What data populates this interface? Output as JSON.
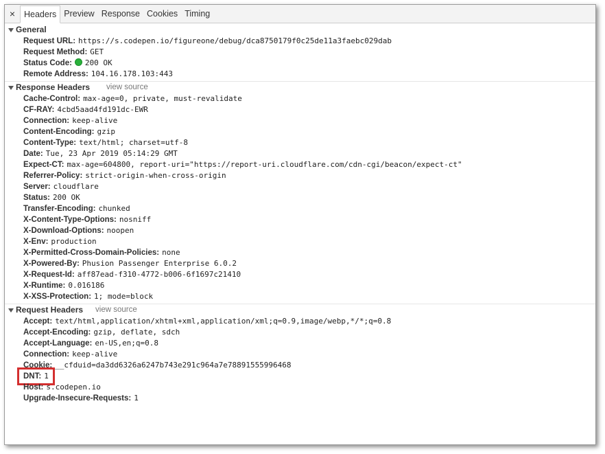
{
  "tabs": {
    "close_icon": "×",
    "items": [
      "Headers",
      "Preview",
      "Response",
      "Cookies",
      "Timing"
    ],
    "active": "Headers"
  },
  "general": {
    "title": "General",
    "rows": [
      {
        "key": "Request URL:",
        "value": "https://s.codepen.io/figureone/debug/dca8750179f0c25de11a3faebc029dab"
      },
      {
        "key": "Request Method:",
        "value": "GET"
      },
      {
        "key": "Status Code:",
        "value": "200 OK",
        "status_color": "#2ab13c"
      },
      {
        "key": "Remote Address:",
        "value": "104.16.178.103:443"
      }
    ]
  },
  "response_headers": {
    "title": "Response Headers",
    "view_source": "view source",
    "rows": [
      {
        "key": "Cache-Control:",
        "value": "max-age=0, private, must-revalidate"
      },
      {
        "key": "CF-RAY:",
        "value": "4cbd5aad4fd191dc-EWR"
      },
      {
        "key": "Connection:",
        "value": "keep-alive"
      },
      {
        "key": "Content-Encoding:",
        "value": "gzip"
      },
      {
        "key": "Content-Type:",
        "value": "text/html; charset=utf-8"
      },
      {
        "key": "Date:",
        "value": "Tue, 23 Apr 2019 05:14:29 GMT"
      },
      {
        "key": "Expect-CT:",
        "value": "max-age=604800, report-uri=\"https://report-uri.cloudflare.com/cdn-cgi/beacon/expect-ct\""
      },
      {
        "key": "Referrer-Policy:",
        "value": "strict-origin-when-cross-origin"
      },
      {
        "key": "Server:",
        "value": "cloudflare"
      },
      {
        "key": "Status:",
        "value": "200 OK"
      },
      {
        "key": "Transfer-Encoding:",
        "value": "chunked"
      },
      {
        "key": "X-Content-Type-Options:",
        "value": "nosniff"
      },
      {
        "key": "X-Download-Options:",
        "value": "noopen"
      },
      {
        "key": "X-Env:",
        "value": "production"
      },
      {
        "key": "X-Permitted-Cross-Domain-Policies:",
        "value": "none"
      },
      {
        "key": "X-Powered-By:",
        "value": "Phusion Passenger Enterprise 6.0.2"
      },
      {
        "key": "X-Request-Id:",
        "value": "aff87ead-f310-4772-b006-6f1697c21410"
      },
      {
        "key": "X-Runtime:",
        "value": "0.016186"
      },
      {
        "key": "X-XSS-Protection:",
        "value": "1; mode=block"
      }
    ]
  },
  "request_headers": {
    "title": "Request Headers",
    "view_source": "view source",
    "rows": [
      {
        "key": "Accept:",
        "value": "text/html,application/xhtml+xml,application/xml;q=0.9,image/webp,*/*;q=0.8"
      },
      {
        "key": "Accept-Encoding:",
        "value": "gzip, deflate, sdch"
      },
      {
        "key": "Accept-Language:",
        "value": "en-US,en;q=0.8"
      },
      {
        "key": "Connection:",
        "value": "keep-alive"
      },
      {
        "key": "Cookie:",
        "value": "__cfduid=da3dd6326a6247b743e291c964a7e78891555996468"
      },
      {
        "key": "DNT:",
        "value": "1",
        "highlighted": true
      },
      {
        "key": "Host:",
        "value": "s.codepen.io"
      },
      {
        "key": "Upgrade-Insecure-Requests:",
        "value": "1"
      }
    ]
  },
  "colors": {
    "highlight_border": "#d32f2f",
    "status_ok": "#2ab13c"
  }
}
